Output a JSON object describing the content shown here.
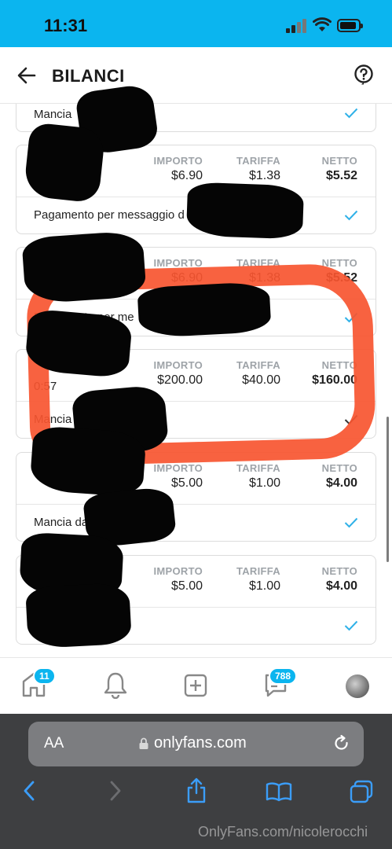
{
  "status_bar": {
    "time": "11:31"
  },
  "header": {
    "title": "BILANCI"
  },
  "column_labels": {
    "amount": "IMPORTO",
    "fee": "TARIFFA",
    "net": "NETTO"
  },
  "transactions": [
    {
      "amount": "$6.90",
      "fee": "$1.38",
      "net": "$5.52",
      "description": "Pagamento per messaggio d"
    },
    {
      "amount": "$6.90",
      "fee": "$1.38",
      "net": "$5.52",
      "description": "Pagamento per me"
    },
    {
      "time": "0:57",
      "amount": "$200.00",
      "fee": "$40.00",
      "net": "$160.00",
      "description": "Mancia d"
    },
    {
      "amount": "$5.00",
      "fee": "$1.00",
      "net": "$4.00",
      "description": "Mancia da"
    },
    {
      "amount": "$5.00",
      "fee": "$1.00",
      "net": "$4.00",
      "description": ""
    }
  ],
  "first_row_partial": {
    "description": "Mancia"
  },
  "bottom_nav": {
    "home_badge": "11",
    "messages_badge": "788"
  },
  "browser": {
    "aa_label": "AA",
    "url": "onlyfans.com"
  },
  "watermark": "OnlyFans.com/nicolerocchi",
  "colors": {
    "accent": "#0bb5ef",
    "highlight": "#f75530",
    "redaction": "#050505"
  }
}
